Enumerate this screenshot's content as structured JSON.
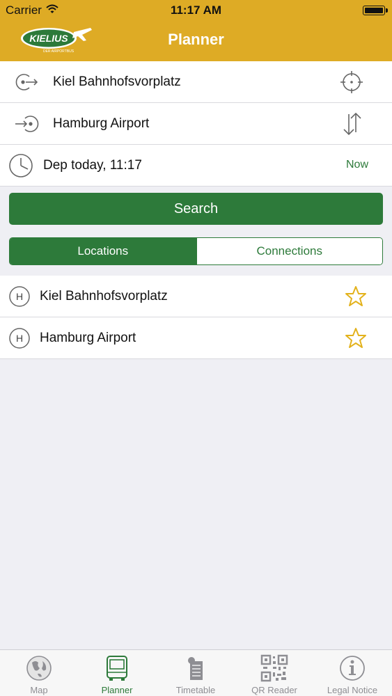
{
  "status": {
    "carrier": "Carrier",
    "time": "11:17 AM"
  },
  "nav": {
    "title": "Planner",
    "logo_text": "KIELIUS",
    "logo_subtext": "DER AIRPORTBUS"
  },
  "trip": {
    "from": "Kiel Bahnhofsvorplatz",
    "to": "Hamburg Airport",
    "departure": "Dep today, 11:17",
    "now_label": "Now"
  },
  "search_label": "Search",
  "segments": {
    "locations": "Locations",
    "connections": "Connections",
    "selected": "Locations"
  },
  "locations": [
    {
      "name": "Kiel Bahnhofsvorplatz",
      "badge": "H"
    },
    {
      "name": "Hamburg Airport",
      "badge": "H"
    }
  ],
  "tabs": [
    {
      "label": "Map",
      "icon": "globe-icon"
    },
    {
      "label": "Planner",
      "icon": "bus-icon"
    },
    {
      "label": "Timetable",
      "icon": "timetable-icon"
    },
    {
      "label": "QR Reader",
      "icon": "qr-code-icon"
    },
    {
      "label": "Legal Notice",
      "icon": "info-icon"
    }
  ],
  "colors": {
    "header": "#deab25",
    "accent_green": "#2d7a3a",
    "star": "#e3b21c"
  }
}
